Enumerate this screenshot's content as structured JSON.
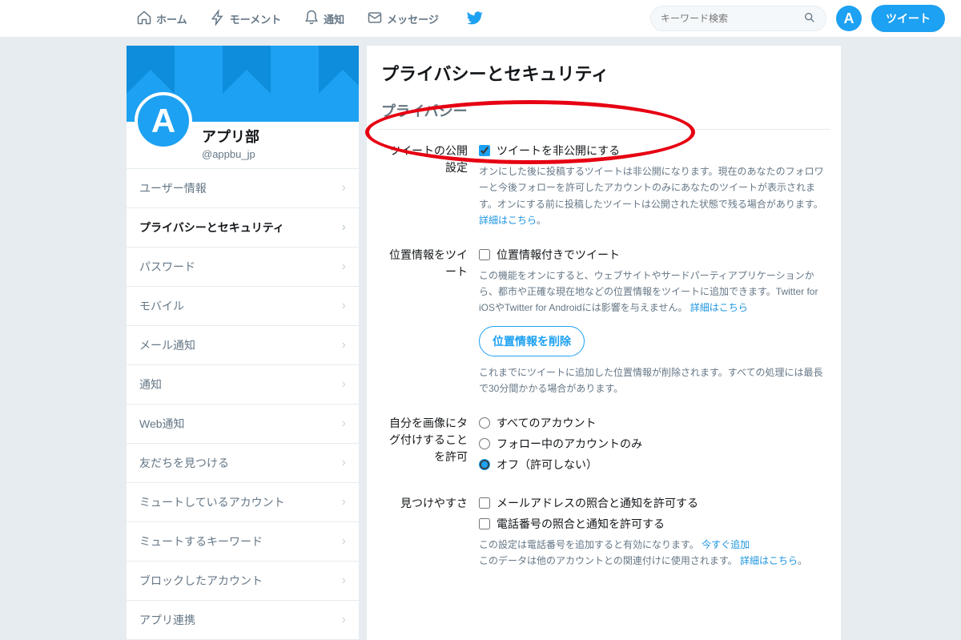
{
  "nav": {
    "home": "ホーム",
    "moments": "モーメント",
    "notifications": "通知",
    "messages": "メッセージ",
    "search_placeholder": "キーワード検索",
    "avatar_letter": "A",
    "tweet_button": "ツイート"
  },
  "profile": {
    "avatar_letter": "A",
    "name": "アプリ部",
    "handle": "@appbu_jp"
  },
  "sidebar": {
    "items": [
      {
        "label": "ユーザー情報"
      },
      {
        "label": "プライバシーとセキュリティ",
        "active": true
      },
      {
        "label": "パスワード"
      },
      {
        "label": "モバイル"
      },
      {
        "label": "メール通知"
      },
      {
        "label": "通知"
      },
      {
        "label": "Web通知"
      },
      {
        "label": "友だちを見つける"
      },
      {
        "label": "ミュートしているアカウント"
      },
      {
        "label": "ミュートするキーワード"
      },
      {
        "label": "ブロックしたアカウント"
      },
      {
        "label": "アプリ連携"
      }
    ]
  },
  "main": {
    "page_title": "プライバシーとセキュリティ",
    "section_privacy": "プライバシー",
    "tweet_privacy": {
      "label": "ツイートの公開設定",
      "checkbox_label": "ツイートを非公開にする",
      "help": "オンにした後に投稿するツイートは非公開になります。現在のあなたのフォロワーと今後フォローを許可したアカウントのみにあなたのツイートが表示されます。オンにする前に投稿したツイートは公開された状態で残る場合があります。",
      "help_link": "詳細はこちら"
    },
    "location": {
      "label": "位置情報をツイート",
      "checkbox_label": "位置情報付きでツイート",
      "help": "この機能をオンにすると、ウェブサイトやサードパーティアプリケーションから、都市や正確な現在地などの位置情報をツイートに追加できます。Twitter for iOSやTwitter for Androidには影響を与えません。",
      "help_link": "詳細はこちら",
      "delete_button": "位置情報を削除",
      "delete_help": "これまでにツイートに追加した位置情報が削除されます。すべての処理には最長で30分間かかる場合があります。"
    },
    "tagging": {
      "label": "自分を画像にタグ付けすることを許可",
      "opt_all": "すべてのアカウント",
      "opt_following": "フォロー中のアカウントのみ",
      "opt_off": "オフ（許可しない）"
    },
    "discoverability": {
      "label": "見つけやすさ",
      "opt_email": "メールアドレスの照合と通知を許可する",
      "opt_phone": "電話番号の照合と通知を許可する",
      "help1a": "この設定は電話番号を追加すると有効になります。",
      "help1_link": "今すぐ追加",
      "help2a": "このデータは他のアカウントとの関連付けに使用されます。",
      "help2_link": "詳細はこちら"
    }
  }
}
